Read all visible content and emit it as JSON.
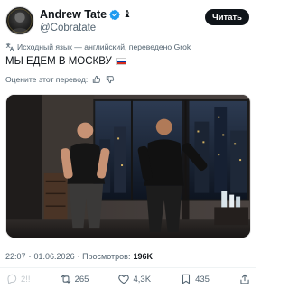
{
  "author": {
    "display_name": "Andrew Tate",
    "handle": "@Cobratate",
    "emoji_suffix": "♝"
  },
  "follow_button": {
    "label": "Читать"
  },
  "translation": {
    "note": "Исходный язык — английский, переведено Grok",
    "rate_label": "Оцените этот перевод:"
  },
  "tweet": {
    "text": "МЫ ЕДЕМ В МОСКВУ"
  },
  "meta": {
    "time": "22:07",
    "separator": "·",
    "date": "01.06.2026",
    "views_label": "· Просмотров:",
    "views_count": "196K"
  },
  "actions": {
    "replies": "2!!",
    "retweets": "265",
    "likes": "4,3K",
    "bookmarks": "435"
  },
  "colors": {
    "text_primary": "#0f1419",
    "text_secondary": "#536471",
    "verified": "#1d9bf0",
    "flag_white": "#ffffff",
    "flag_blue": "#0039a6",
    "flag_red": "#d52b1e"
  }
}
